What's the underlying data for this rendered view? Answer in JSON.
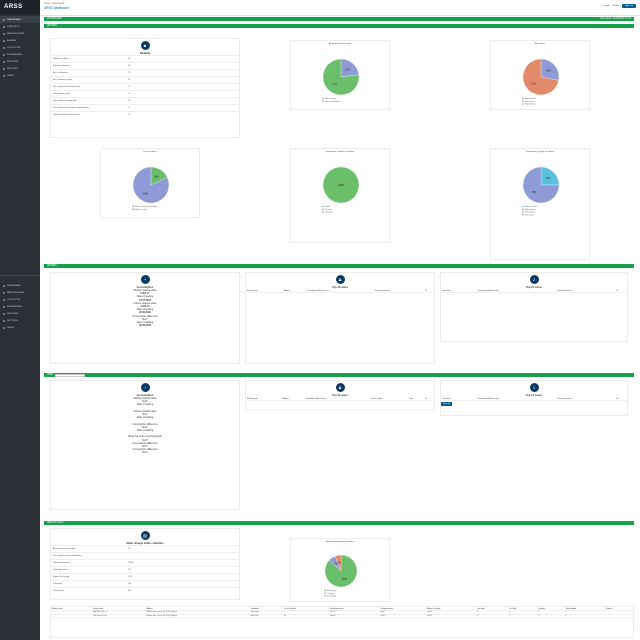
{
  "app": {
    "logo": "ARSS"
  },
  "sidebar": {
    "items": [
      {
        "label": "DASHBOARD",
        "active": true
      },
      {
        "label": "STATISTICS"
      },
      {
        "label": "MAPPING ALERT"
      },
      {
        "label": "ALARMS"
      },
      {
        "label": "COLLECTOR"
      },
      {
        "label": "ENGINEERING"
      },
      {
        "label": "NETWORK"
      },
      {
        "label": "SETTINGS"
      },
      {
        "label": "TASKS"
      }
    ],
    "items2": [
      {
        "label": "DASHBOARD"
      },
      {
        "label": "MAPPING ALERT"
      },
      {
        "label": "COLLECTOR"
      },
      {
        "label": "ENGINEERING"
      },
      {
        "label": "NETWORK"
      },
      {
        "label": "SETTINGS"
      },
      {
        "label": "TASKS"
      }
    ]
  },
  "header": {
    "breadcrumb": "Home / Dashboard",
    "title": "ARSS dashboard",
    "links": [
      "Logout",
      "Profile"
    ],
    "button": "Sign out"
  },
  "bars": {
    "top": "DASHBOARD",
    "top_right": "Last refresh: 01.09.2022 07:43",
    "reading": "READING",
    "meters": "METERS",
    "date": "DATE",
    "daily": "REMOTE DAILY"
  },
  "reading_card": {
    "title": "Reading",
    "rows": [
      {
        "k": "Number of clients",
        "v": "21"
      },
      {
        "k": "Number of houses",
        "v": "21"
      },
      {
        "k": "No. of all meters",
        "v": "71"
      },
      {
        "k": "No. of meters (active)",
        "v": "47"
      },
      {
        "k": "No. of meters not read (active)",
        "v": "0"
      },
      {
        "k": "No. of meters read",
        "v": "0"
      },
      {
        "k": "No. of meters reading data",
        "v": "47"
      },
      {
        "k": "No. of lost meters (without consumption)",
        "v": "0"
      },
      {
        "k": "Number of meters with alarms",
        "v": "0"
      }
    ]
  },
  "consumption_card": {
    "title": "Consumption",
    "lines": [
      "Starting readout value",
      "2.401 m³",
      "Date of reading",
      "31.07.2022",
      "Current readout value",
      "4.102 m³",
      "Date of reading",
      "02.09.2022",
      "Consumption difference",
      "0 m³",
      "Date of reading",
      "02.09.2022"
    ]
  },
  "consumption_card2": {
    "title": "Consumption",
    "lines": [
      "Starting readout value",
      "0 m³",
      "Date of reading",
      "-",
      "Current readout value",
      "0 m³",
      "Date of reading",
      "-",
      "Consumption difference",
      "0 m³",
      "Date of reading",
      "-",
      "Meter log in an extended period",
      "0 m³",
      "Consumption difference",
      "0 m³",
      "Consumption difference",
      "0 m³"
    ]
  },
  "top_users": {
    "title": "Top 10 users",
    "cols": [
      "Metering point",
      "Address",
      "Consumption difference (m³)",
      "Current readout (m³)",
      "Id"
    ]
  },
  "top_zones": {
    "title": "Top 10 zones",
    "cols": [
      "Zone name",
      "Consumption difference (m³)",
      "Current readout (m³)",
      "Id"
    ]
  },
  "date_filter": {
    "label": "DATE"
  },
  "top_users2": {
    "title": "Top 10 users",
    "cols": [
      "Metering point",
      "Address",
      "Consumption difference (m³)",
      "Current readout",
      "Zone",
      "Id"
    ]
  },
  "top_zones2": {
    "title": "Top 10 zones",
    "cols": [
      "Zone name",
      "Consumption difference (m³)",
      "Current readout (m³)",
      "Id"
    ],
    "button": "Show all"
  },
  "meter_change": {
    "title": "Meter change status statistics",
    "rows": [
      {
        "k": "All meters to be changed",
        "v": "21"
      },
      {
        "k": "No. of meters with installed.com",
        "v": ""
      },
      {
        "k": "Remaining meters",
        "v": "(21%)"
      },
      {
        "k": "Changed meters",
        "v": "7%"
      },
      {
        "k": "Meters for change",
        "v": "17%"
      },
      {
        "k": "Cancelled",
        "v": "0%"
      },
      {
        "k": "Other status",
        "v": "0%"
      }
    ]
  },
  "bottom_table": {
    "cols": [
      "Metering point",
      "Sender name",
      "Address",
      "Installation",
      "No. of all meters",
      "Remaining meters",
      "Changed meters",
      "Meters for change",
      "Lost meter",
      "No. Bond",
      "Lastdate",
      "Step changed",
      "Remarks"
    ],
    "rows": [
      [
        "",
        "BMK Barcel (el.) 01",
        "Mladen Iadin v jeszcz 16, 1010 Ljubljana",
        "Sent meter",
        "5",
        "Total 3",
        "Total 1",
        "Total 1",
        "0",
        "0",
        "0",
        "0",
        ""
      ],
      [
        "",
        "Test Barcel (el.) 02",
        "Mladen Iadin v jeszcz 16, 1010 Ljubljana",
        "Test meter",
        "16",
        "Total 10",
        "Total 4",
        "Total 2",
        "0",
        "0",
        "0",
        "0",
        ""
      ]
    ]
  },
  "chart_data": [
    {
      "type": "pie",
      "title": "All meters on this route",
      "labels": [
        "Water meters",
        "Heat cost allocators"
      ],
      "values": [
        23,
        77
      ],
      "colors": [
        "#8e9bd6",
        "#6bbf6a"
      ]
    },
    {
      "type": "pie",
      "title": "All meters",
      "labels": [
        "Water meters",
        "Heat meters",
        "Radio meters"
      ],
      "values": [
        28,
        72,
        0
      ],
      "colors": [
        "#8e9bd6",
        "#e28a6a",
        "#6bbf6a"
      ]
    },
    {
      "type": "pie",
      "title": "Device status",
      "labels": [
        "Meter is read in the last day",
        "Meter not read"
      ],
      "values": [
        18,
        82
      ],
      "colors": [
        "#6bbf6a",
        "#8e9bd6"
      ]
    },
    {
      "type": "pie",
      "title": "Installation: number of meters",
      "labels": [
        "Valves",
        "Sensors",
        "Gateways"
      ],
      "values": [
        100,
        0,
        0
      ],
      "colors": [
        "#6bbf6a",
        "#e28a6a",
        "#8e9bd6"
      ]
    },
    {
      "type": "pie",
      "title": "Distribution by type of meters",
      "labels": [
        "Electric meters",
        "Water meters",
        "Heat meters",
        "Gas meters"
      ],
      "values": [
        25,
        75,
        0,
        0
      ],
      "colors": [
        "#5bc0de",
        "#8e9bd6",
        "#6bbf6a",
        "#e28a6a"
      ]
    },
    {
      "type": "pie",
      "title": "Meter change status statistics",
      "labels": [
        "Remaining",
        "Changed",
        "For change"
      ],
      "values": [
        87,
        7,
        6
      ],
      "colors": [
        "#6bbf6a",
        "#8e9bd6",
        "#e28a6a"
      ]
    }
  ]
}
